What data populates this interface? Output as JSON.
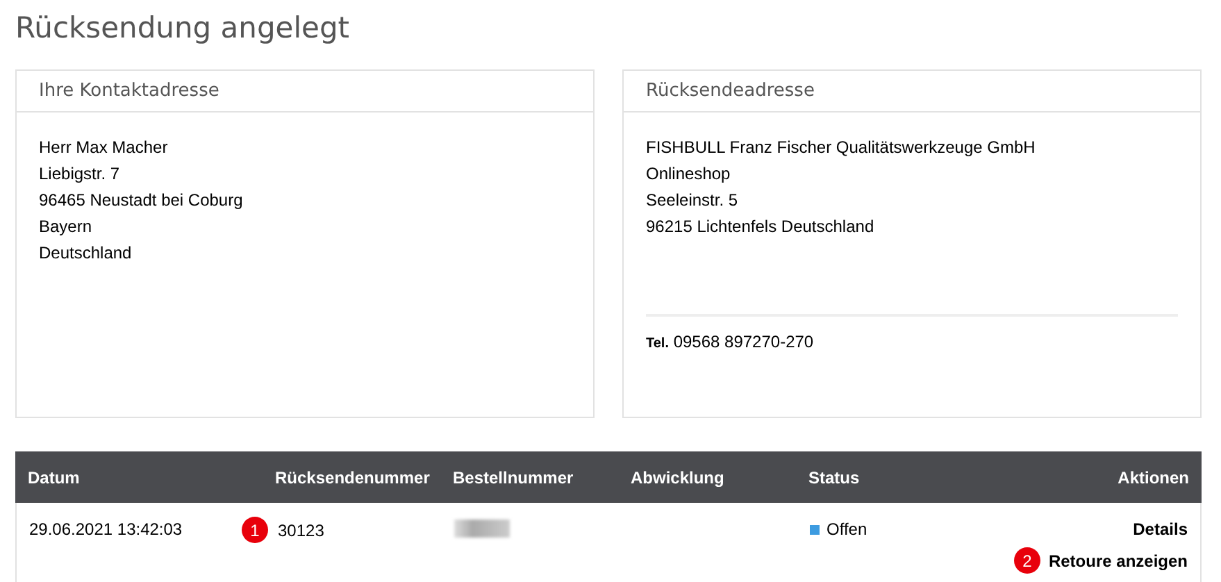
{
  "title": "Rücksendung angelegt",
  "cards": [
    {
      "title": "Ihre Kontaktadresse",
      "lines": [
        "Herr Max Macher",
        "Liebigstr. 7",
        "96465 Neustadt bei Coburg",
        "Bayern",
        "Deutschland"
      ]
    },
    {
      "title": "Rücksendeadresse",
      "lines": [
        "FISHBULL Franz Fischer Qualitätswerkzeuge GmbH",
        "Onlineshop",
        "Seeleinstr. 5",
        "96215 Lichtenfels Deutschland"
      ],
      "phone_label": "Tel.",
      "phone": "09568 897270-270"
    }
  ],
  "table": {
    "columns": [
      "Datum",
      "Rücksendenummer",
      "Bestellnummer",
      "Abwicklung",
      "Status",
      "Aktionen"
    ],
    "rows": [
      {
        "date": "29.06.2021 13:42:03",
        "number_marker": "1",
        "number": "30123",
        "order_blurred": true,
        "status": "Offen",
        "color": "#3d9be0",
        "actions": [
          {
            "label": "Details"
          },
          {
            "label": "Retoure anzeigen",
            "marker": "2"
          }
        ]
      }
    ]
  }
}
